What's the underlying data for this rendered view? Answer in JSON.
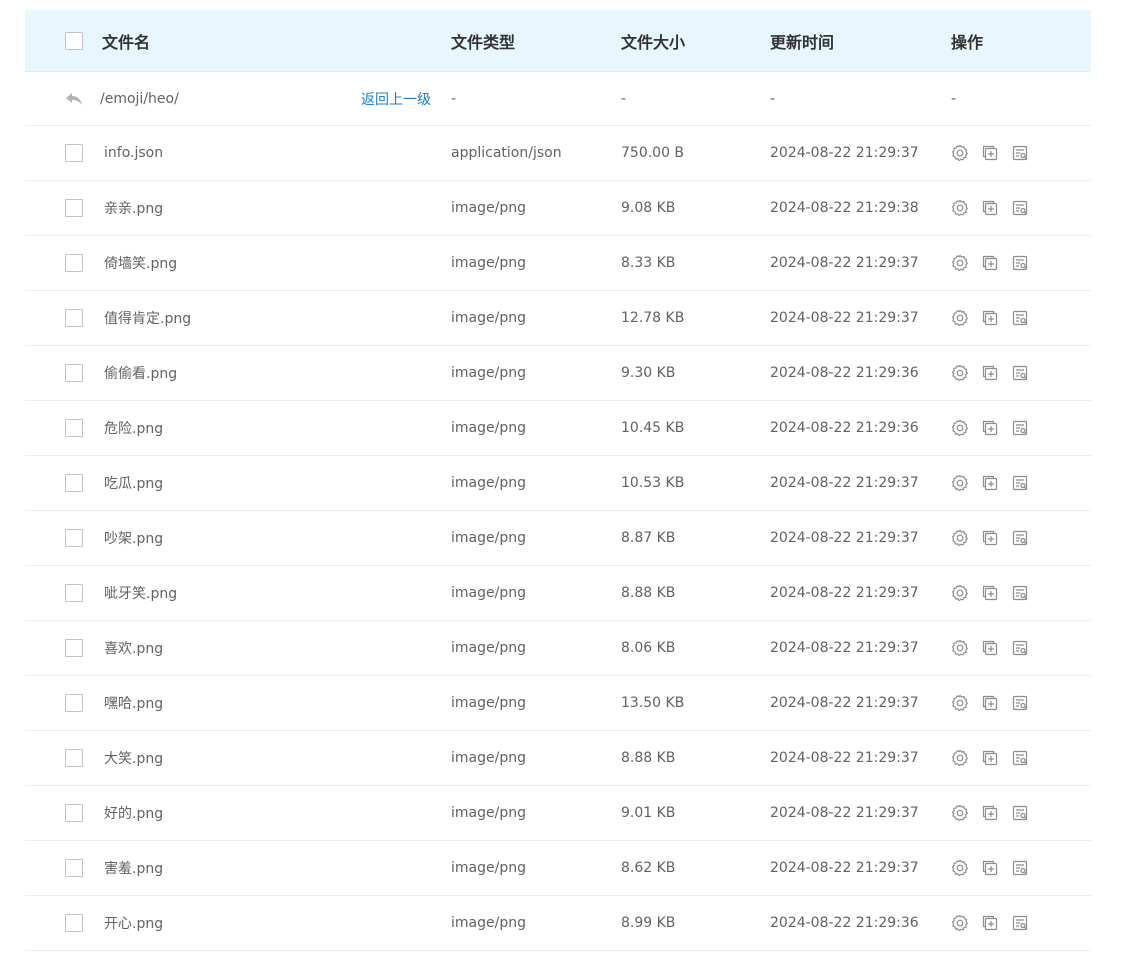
{
  "header": {
    "name": "文件名",
    "type": "文件类型",
    "size": "文件大小",
    "time": "更新时间",
    "ops": "操作"
  },
  "back_row": {
    "path": "/emoji/heo/",
    "link": "返回上一级",
    "type": "-",
    "size": "-",
    "time": "-",
    "ops": "-"
  },
  "files": [
    {
      "name": "info.json",
      "type": "application/json",
      "size": "750.00 B",
      "time": "2024-08-22 21:29:37"
    },
    {
      "name": "亲亲.png",
      "type": "image/png",
      "size": "9.08 KB",
      "time": "2024-08-22 21:29:38"
    },
    {
      "name": "倚墙笑.png",
      "type": "image/png",
      "size": "8.33 KB",
      "time": "2024-08-22 21:29:37"
    },
    {
      "name": "值得肯定.png",
      "type": "image/png",
      "size": "12.78 KB",
      "time": "2024-08-22 21:29:37"
    },
    {
      "name": "偷偷看.png",
      "type": "image/png",
      "size": "9.30 KB",
      "time": "2024-08-22 21:29:36"
    },
    {
      "name": "危险.png",
      "type": "image/png",
      "size": "10.45 KB",
      "time": "2024-08-22 21:29:36"
    },
    {
      "name": "吃瓜.png",
      "type": "image/png",
      "size": "10.53 KB",
      "time": "2024-08-22 21:29:37"
    },
    {
      "name": "吵架.png",
      "type": "image/png",
      "size": "8.87 KB",
      "time": "2024-08-22 21:29:37"
    },
    {
      "name": "呲牙笑.png",
      "type": "image/png",
      "size": "8.88 KB",
      "time": "2024-08-22 21:29:37"
    },
    {
      "name": "喜欢.png",
      "type": "image/png",
      "size": "8.06 KB",
      "time": "2024-08-22 21:29:37"
    },
    {
      "name": "嘿哈.png",
      "type": "image/png",
      "size": "13.50 KB",
      "time": "2024-08-22 21:29:37"
    },
    {
      "name": "大笑.png",
      "type": "image/png",
      "size": "8.88 KB",
      "time": "2024-08-22 21:29:37"
    },
    {
      "name": "好的.png",
      "type": "image/png",
      "size": "9.01 KB",
      "time": "2024-08-22 21:29:37"
    },
    {
      "name": "害羞.png",
      "type": "image/png",
      "size": "8.62 KB",
      "time": "2024-08-22 21:29:37"
    },
    {
      "name": "开心.png",
      "type": "image/png",
      "size": "8.99 KB",
      "time": "2024-08-22 21:29:36"
    }
  ],
  "icons": {
    "back": "reply-arrow-icon",
    "settings": "gear-icon",
    "copy": "copy-plus-icon",
    "details": "document-details-icon"
  },
  "colors": {
    "header_bg": "#e8f6fe",
    "link": "#1e7fd0",
    "border": "#ebeef5",
    "text": "#606266"
  }
}
